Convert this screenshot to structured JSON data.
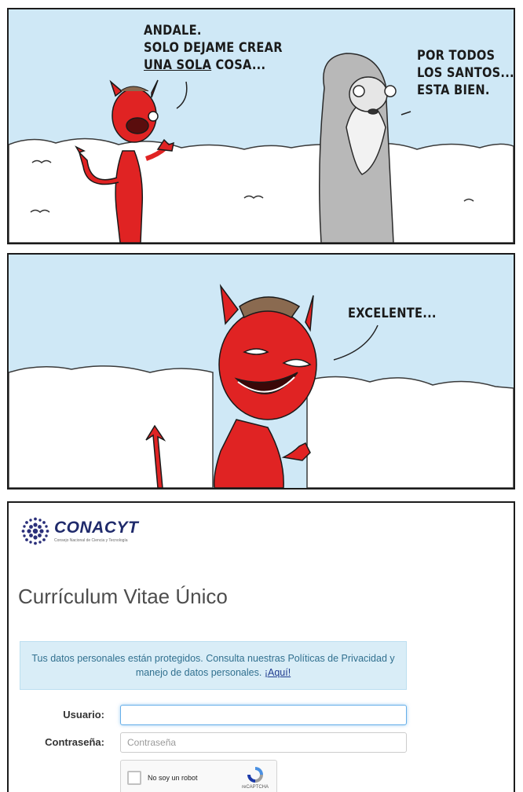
{
  "comic": {
    "panel1": {
      "devil_speech": {
        "line1": "ANDALE.",
        "line2": "SOLO DEJAME CREAR",
        "line3_underlined": "UNA SOLA",
        "line3_rest": " COSA..."
      },
      "god_speech": {
        "line1": "POR TODOS",
        "line2": "LOS SANTOS...",
        "line3": "ESTA BIEN."
      }
    },
    "panel2": {
      "devil_speech": "EXCELENTE..."
    }
  },
  "login": {
    "logo_text": "CONACYT",
    "logo_subtitle": "Consejo Nacional de Ciencia y Tecnología",
    "page_title": "Currículum Vitae Único",
    "notice_text": "Tus datos personales están protegidos. Consulta nuestras Políticas de Privacidad y manejo de datos personales.",
    "notice_link": "¡Aquí!",
    "username_label": "Usuario:",
    "username_value": "",
    "password_label": "Contraseña:",
    "password_placeholder": "Contraseña",
    "captcha_label": "No soy un robot",
    "captcha_brand": "reCAPTCHA"
  },
  "colors": {
    "sky": "#cfe8f6",
    "devil_red": "#e02323",
    "notice_bg": "#d9edf7",
    "notice_text": "#31708f",
    "brand_blue": "#1f2a6b"
  }
}
